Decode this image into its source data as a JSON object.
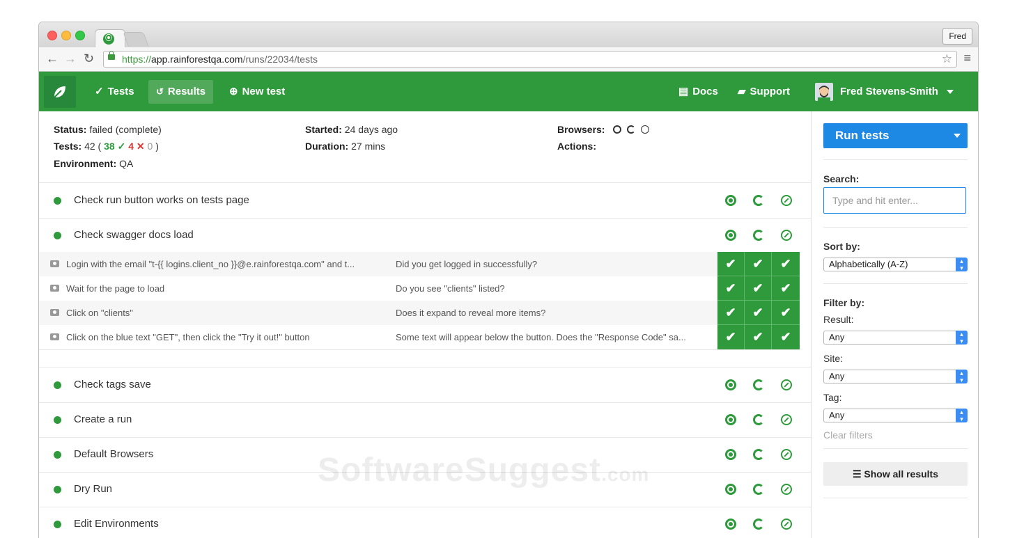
{
  "browser": {
    "profile": "Fred",
    "url_scheme": "https://",
    "url_host": "app.rainforestqa.com",
    "url_path": "/runs/22034/tests"
  },
  "nav": {
    "tests": "Tests",
    "results": "Results",
    "new_test": "New test",
    "docs": "Docs",
    "support": "Support",
    "user": "Fred Stevens-Smith"
  },
  "summary": {
    "status_label": "Status:",
    "status_value": "failed (complete)",
    "tests_label": "Tests:",
    "tests_total": "42",
    "tests_passed": "38",
    "tests_failed": "4",
    "tests_skipped": "0",
    "environment_label": "Environment:",
    "environment_value": "QA",
    "started_label": "Started:",
    "started_value": "24 days ago",
    "duration_label": "Duration:",
    "duration_value": "27 mins",
    "browsers_label": "Browsers:",
    "actions_label": "Actions:"
  },
  "tests": [
    {
      "title": "Check run button works on tests page"
    },
    {
      "title": "Check swagger docs load"
    },
    {
      "title": "Check tags save"
    },
    {
      "title": "Create a run"
    },
    {
      "title": "Default Browsers"
    },
    {
      "title": "Dry Run"
    },
    {
      "title": "Edit Environments"
    }
  ],
  "steps": [
    {
      "action": "Login with the email \"t-{{ logins.client_no }}@e.rainforestqa.com\" and t...",
      "question": "Did you get logged in successfully?"
    },
    {
      "action": "Wait for the page to load",
      "question": "Do you see \"clients\" listed?"
    },
    {
      "action": "Click on \"clients\"",
      "question": "Does it expand to reveal more items?"
    },
    {
      "action": "Click on the blue text \"GET\", then click the \"Try it out!\" button",
      "question": "Some text will appear below the button. Does the \"Response Code\" sa..."
    }
  ],
  "check": "✔",
  "sidebar": {
    "run_tests": "Run tests",
    "search_label": "Search:",
    "search_placeholder": "Type and hit enter...",
    "sort_label": "Sort by:",
    "sort_value": "Alphabetically (A-Z)",
    "filter_label": "Filter by:",
    "result_label": "Result:",
    "result_value": "Any",
    "site_label": "Site:",
    "site_value": "Any",
    "tag_label": "Tag:",
    "tag_value": "Any",
    "clear_filters": "Clear filters",
    "show_all": "Show all results"
  },
  "watermark": {
    "main": "SoftwareSuggest",
    "suffix": ".com"
  },
  "colors": {
    "brand_green": "#2e9a3c",
    "accent_blue": "#1e88e5",
    "fail_red": "#dd3333"
  }
}
